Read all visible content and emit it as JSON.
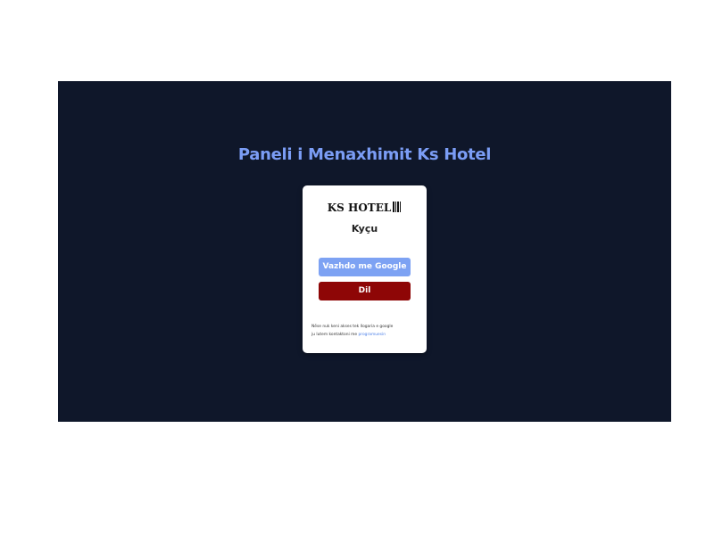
{
  "page": {
    "title": "Paneli i Menaxhimit Ks Hotel"
  },
  "card": {
    "logo_text": "KS HOTEL",
    "heading": "Kyçu"
  },
  "buttons": {
    "google_label": "Vazhdo me Google",
    "exit_label": "Dil"
  },
  "note": {
    "line1": "Nëse nuk keni akses tek llogaria e google",
    "line2_prefix": "ju lutem kontaktoni me",
    "link_text": "programuesin"
  },
  "colors": {
    "background": "#0f172a",
    "title": "#7b9df5",
    "google_button": "#7da2f3",
    "exit_button": "#8e0606",
    "link": "#4a7fe8"
  }
}
